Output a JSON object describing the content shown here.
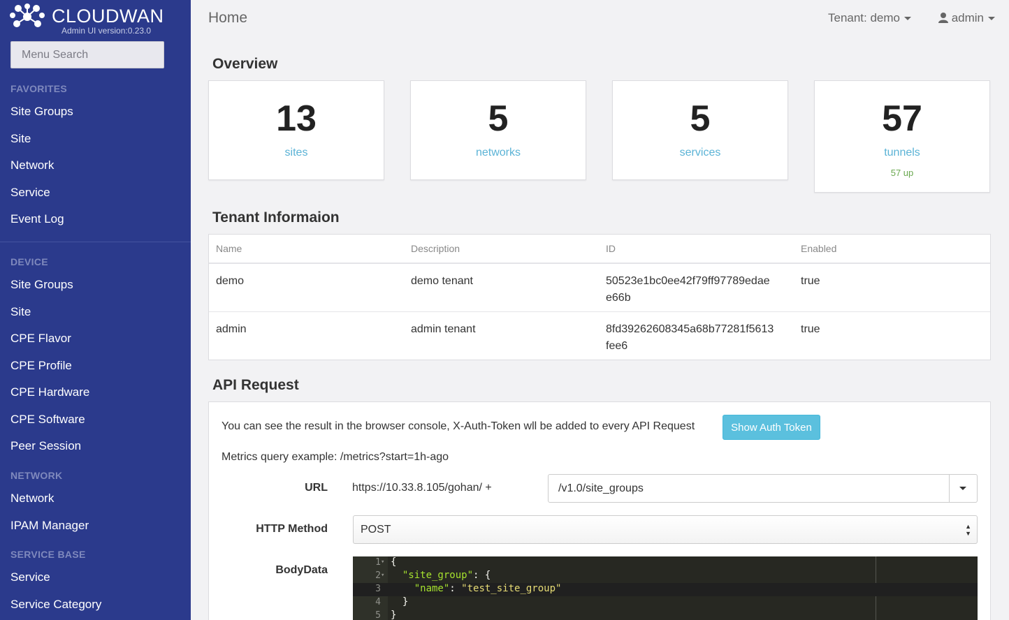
{
  "brand": {
    "name": "CLOUDWAN",
    "version": "Admin UI version:0.23.0"
  },
  "sidebar": {
    "search_placeholder": "Menu Search",
    "sections": [
      {
        "label": "FAVORITES",
        "items": [
          "Site Groups",
          "Site",
          "Network",
          "Service",
          "Event Log"
        ]
      },
      {
        "label": "DEVICE",
        "items": [
          "Site Groups",
          "Site",
          "CPE Flavor",
          "CPE Profile",
          "CPE Hardware",
          "CPE Software",
          "Peer Session"
        ]
      },
      {
        "label": "NETWORK",
        "items": [
          "Network",
          "IPAM Manager"
        ]
      },
      {
        "label": "SERVICE BASE",
        "items": [
          "Service",
          "Service Category"
        ]
      }
    ]
  },
  "header": {
    "title": "Home",
    "tenant": "Tenant: demo",
    "user": "admin"
  },
  "overview": {
    "title": "Overview",
    "cards": [
      {
        "value": "13",
        "label": "sites"
      },
      {
        "value": "5",
        "label": "networks"
      },
      {
        "value": "5",
        "label": "services"
      },
      {
        "value": "57",
        "label": "tunnels",
        "sub": "57 up"
      }
    ]
  },
  "tenant_info": {
    "title": "Tenant Informaion",
    "columns": [
      "Name",
      "Description",
      "ID",
      "Enabled"
    ],
    "rows": [
      {
        "name": "demo",
        "description": "demo tenant",
        "id_line1": "50523e1bc0ee42f79ff97789edae",
        "id_line2": "e66b",
        "enabled": "true"
      },
      {
        "name": "admin",
        "description": "admin tenant",
        "id_line1": "8fd39262608345a68b77281f5613",
        "id_line2": "fee6",
        "enabled": "true"
      }
    ]
  },
  "api": {
    "title": "API Request",
    "note": "You can see the result in the browser console, X-Auth-Token wll be added to every API Request",
    "auth_button": "Show Auth Token",
    "metrics_note": "Metrics query example: /metrics?start=1h-ago",
    "url_label": "URL",
    "url_prefix": "https://10.33.8.105/gohan/ +",
    "url_value": "/v1.0/site_groups",
    "method_label": "HTTP Method",
    "method_value": "POST",
    "body_label": "BodyData",
    "body_lines": [
      {
        "num": "1",
        "text": "{"
      },
      {
        "num": "2",
        "key": "\"site_group\"",
        "rest": ": {"
      },
      {
        "num": "3",
        "key": "\"name\"",
        "mid": ": ",
        "str": "\"test_site_group\""
      },
      {
        "num": "4",
        "text": "  }"
      },
      {
        "num": "5",
        "text": "}"
      }
    ]
  }
}
